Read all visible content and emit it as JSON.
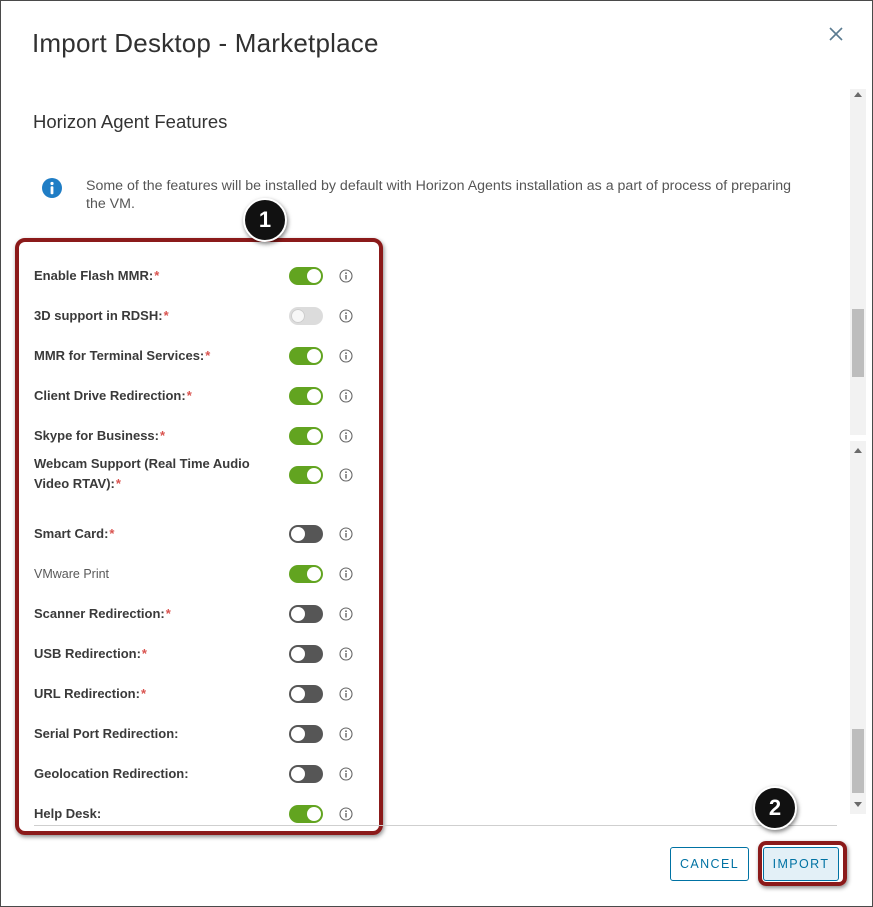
{
  "dialog": {
    "title": "Import Desktop - Marketplace",
    "close_icon": "close-icon"
  },
  "section": {
    "title": "Horizon Agent Features",
    "info_icon": "info-circle-icon",
    "info_text": "Some of the features will be installed by default with Horizon Agents installation as a part of process of preparing the VM."
  },
  "features": [
    {
      "label": "Enable Flash MMR:",
      "required": "*",
      "state": "on"
    },
    {
      "label": "3D support in RDSH:",
      "required": "*",
      "state": "disabled"
    },
    {
      "label": "MMR for Terminal Services:",
      "required": "*",
      "state": "on"
    },
    {
      "label": "Client Drive Redirection:",
      "required": "*",
      "state": "on"
    },
    {
      "label": "Skype for Business:",
      "required": "*",
      "state": "on"
    },
    {
      "label": "Webcam Support (Real Time Audio Video RTAV):",
      "required": "*",
      "state": "on"
    },
    {
      "label": "Smart Card:",
      "required": "*",
      "state": "off"
    },
    {
      "label": "VMware Print",
      "required": "",
      "state": "on"
    },
    {
      "label": "Scanner Redirection:",
      "required": "*",
      "state": "off"
    },
    {
      "label": "USB Redirection:",
      "required": "*",
      "state": "off"
    },
    {
      "label": "URL Redirection:",
      "required": "*",
      "state": "off"
    },
    {
      "label": "Serial Port Redirection:",
      "required": "",
      "state": "off"
    },
    {
      "label": "Geolocation Redirection:",
      "required": "",
      "state": "off"
    },
    {
      "label": "Help Desk:",
      "required": "",
      "state": "on"
    }
  ],
  "annotations": {
    "step1": "1",
    "step2": "2"
  },
  "footer": {
    "cancel_label": "CANCEL",
    "import_label": "IMPORT"
  },
  "colors": {
    "toggle_on": "#62a420",
    "toggle_off": "#565656",
    "accent": "#0072a3",
    "highlight": "#8b1a1a",
    "required": "#d9534f"
  }
}
